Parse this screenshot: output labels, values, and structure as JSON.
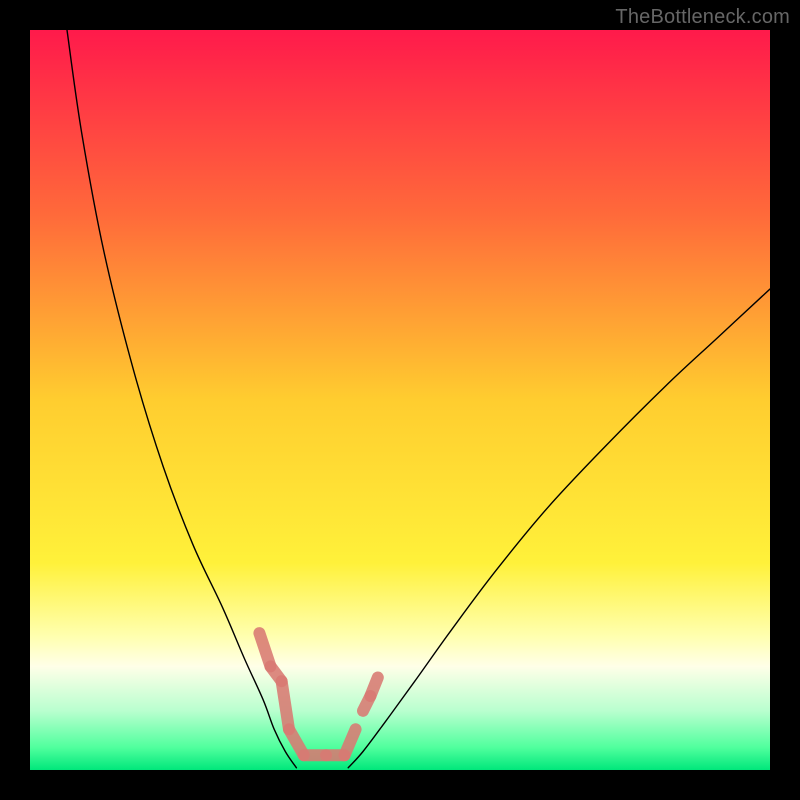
{
  "watermark": "TheBottleneck.com",
  "chart_data": {
    "type": "line",
    "title": "",
    "xlabel": "",
    "ylabel": "",
    "xlim": [
      0,
      100
    ],
    "ylim": [
      0,
      100
    ],
    "background_gradient": {
      "stops": [
        {
          "offset": 0.0,
          "color": "#ff1a4b"
        },
        {
          "offset": 0.25,
          "color": "#ff6a3a"
        },
        {
          "offset": 0.5,
          "color": "#ffcd2f"
        },
        {
          "offset": 0.72,
          "color": "#fff13a"
        },
        {
          "offset": 0.82,
          "color": "#ffffb0"
        },
        {
          "offset": 0.86,
          "color": "#ffffe8"
        },
        {
          "offset": 0.92,
          "color": "#b9ffcf"
        },
        {
          "offset": 0.97,
          "color": "#4fff9d"
        },
        {
          "offset": 1.0,
          "color": "#00e77b"
        }
      ]
    },
    "series": [
      {
        "name": "left-branch",
        "x": [
          5.0,
          7.0,
          10.0,
          14.0,
          18.0,
          22.0,
          26.0,
          29.0,
          31.5,
          33.0,
          34.5,
          36.0
        ],
        "y": [
          100.0,
          86.0,
          70.0,
          54.0,
          41.0,
          30.5,
          22.0,
          15.0,
          9.5,
          5.5,
          2.5,
          0.3
        ]
      },
      {
        "name": "right-branch",
        "x": [
          43.0,
          45.0,
          48.0,
          52.0,
          57.0,
          63.0,
          70.0,
          78.0,
          86.0,
          93.0,
          100.0
        ],
        "y": [
          0.3,
          2.5,
          6.5,
          12.0,
          19.0,
          27.0,
          35.5,
          44.0,
          52.0,
          58.5,
          65.0
        ]
      }
    ],
    "highlight_region": {
      "comment": "salmon dashed cluster near trough",
      "segments": [
        {
          "x": [
            31.0,
            32.5
          ],
          "y": [
            18.5,
            14.0
          ]
        },
        {
          "x": [
            32.5,
            34.0
          ],
          "y": [
            14.0,
            12.0
          ]
        },
        {
          "x": [
            34.0,
            35.0
          ],
          "y": [
            12.0,
            5.5
          ]
        },
        {
          "x": [
            35.0,
            37.0
          ],
          "y": [
            5.5,
            2.0
          ]
        },
        {
          "x": [
            37.0,
            40.0
          ],
          "y": [
            2.0,
            2.0
          ]
        },
        {
          "x": [
            40.0,
            42.5
          ],
          "y": [
            2.0,
            2.0
          ]
        },
        {
          "x": [
            42.5,
            44.0
          ],
          "y": [
            2.0,
            5.5
          ]
        },
        {
          "x": [
            45.0,
            46.0
          ],
          "y": [
            8.0,
            10.0
          ]
        },
        {
          "x": [
            46.0,
            47.0
          ],
          "y": [
            10.0,
            12.5
          ]
        }
      ],
      "color": "#d97a73",
      "stroke_width": 12
    },
    "curve_color": "#000000",
    "curve_width": 1.4
  }
}
